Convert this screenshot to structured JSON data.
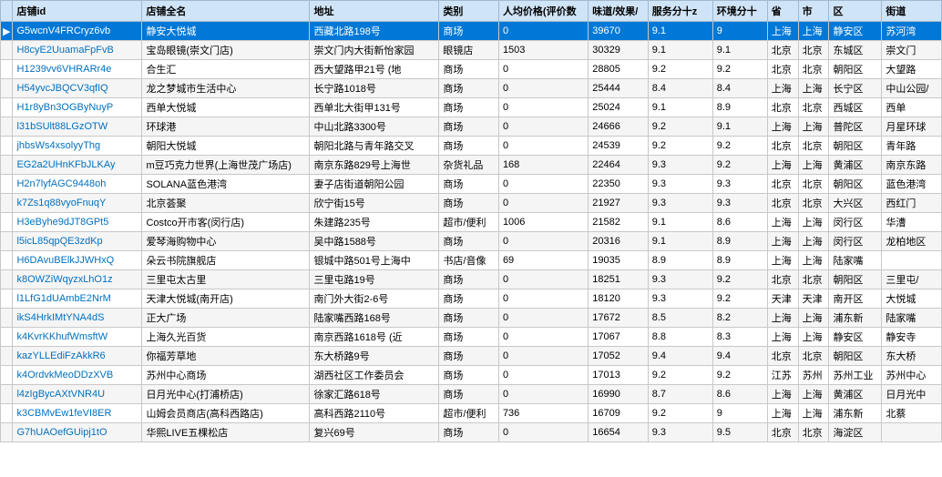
{
  "table": {
    "columns": [
      {
        "key": "arrow",
        "label": ""
      },
      {
        "key": "id",
        "label": "店铺id"
      },
      {
        "key": "full_name",
        "label": "店铺全名"
      },
      {
        "key": "address",
        "label": "地址"
      },
      {
        "key": "category",
        "label": "类别"
      },
      {
        "key": "avg_price",
        "label": "人均价格(评价数"
      },
      {
        "key": "taste",
        "label": "味道/效果/"
      },
      {
        "key": "service",
        "label": "服务分十z"
      },
      {
        "key": "env",
        "label": "环境分十"
      },
      {
        "key": "province",
        "label": "省"
      },
      {
        "key": "city",
        "label": "市"
      },
      {
        "key": "district",
        "label": "区"
      },
      {
        "key": "street",
        "label": "街道"
      }
    ],
    "rows": [
      {
        "arrow": "▶",
        "id": "G5wcnV4FRCryz6vb",
        "full_name": "静安大悦城",
        "address": "西藏北路198号",
        "category": "商场",
        "avg_price": "0",
        "taste": "39670",
        "service": "9.1",
        "env": "9",
        "province": "上海",
        "city": "上海",
        "district": "静安区",
        "street": "苏河湾",
        "selected": true
      },
      {
        "arrow": "",
        "id": "H8cyE2UuamaFpFvB",
        "full_name": "宝岛眼镜(崇文门店)",
        "address": "崇文门内大街新怡家园",
        "category": "眼镜店",
        "avg_price": "1503",
        "taste": "30329",
        "service": "9.1",
        "env": "9.1",
        "province": "北京",
        "city": "北京",
        "district": "东城区",
        "street": "崇文门"
      },
      {
        "arrow": "",
        "id": "H1239vv6VHRARr4e",
        "full_name": "合生汇",
        "address": "西大望路甲21号 (地",
        "category": "商场",
        "avg_price": "0",
        "taste": "28805",
        "service": "9.2",
        "env": "9.2",
        "province": "北京",
        "city": "北京",
        "district": "朝阳区",
        "street": "大望路"
      },
      {
        "arrow": "",
        "id": "H54yvcJBQCV3qfIQ",
        "full_name": "龙之梦城市生活中心",
        "address": "长宁路1018号",
        "category": "商场",
        "avg_price": "0",
        "taste": "25444",
        "service": "8.4",
        "env": "8.4",
        "province": "上海",
        "city": "上海",
        "district": "长宁区",
        "street": "中山公园/"
      },
      {
        "arrow": "",
        "id": "H1r8yBn3OGByNuyP",
        "full_name": "西单大悦城",
        "address": "西单北大街甲131号",
        "category": "商场",
        "avg_price": "0",
        "taste": "25024",
        "service": "9.1",
        "env": "8.9",
        "province": "北京",
        "city": "北京",
        "district": "西城区",
        "street": "西单"
      },
      {
        "arrow": "",
        "id": "l31bSUlt88LGzOTW",
        "full_name": "环球港",
        "address": "中山北路3300号",
        "category": "商场",
        "avg_price": "0",
        "taste": "24666",
        "service": "9.2",
        "env": "9.1",
        "province": "上海",
        "city": "上海",
        "district": "普陀区",
        "street": "月星环球"
      },
      {
        "arrow": "",
        "id": "jhbsWs4xsolyyThg",
        "full_name": "朝阳大悦城",
        "address": "朝阳北路与青年路交叉",
        "category": "商场",
        "avg_price": "0",
        "taste": "24539",
        "service": "9.2",
        "env": "9.2",
        "province": "北京",
        "city": "北京",
        "district": "朝阳区",
        "street": "青年路"
      },
      {
        "arrow": "",
        "id": "EG2a2UHnKFbJLKAy",
        "full_name": "m豆巧克力世界(上海世茂广场店)",
        "address": "南京东路829号上海世",
        "category": "杂货礼品",
        "avg_price": "168",
        "taste": "22464",
        "service": "9.3",
        "env": "9.2",
        "province": "上海",
        "city": "上海",
        "district": "黄浦区",
        "street": "南京东路"
      },
      {
        "arrow": "",
        "id": "H2n7lyfAGC9448oh",
        "full_name": "SOLANA蓝色港湾",
        "address": "妻子店街道朝阳公园",
        "category": "商场",
        "avg_price": "0",
        "taste": "22350",
        "service": "9.3",
        "env": "9.3",
        "province": "北京",
        "city": "北京",
        "district": "朝阳区",
        "street": "蓝色港湾"
      },
      {
        "arrow": "",
        "id": "k7Zs1q88vyoFnuqY",
        "full_name": "北京荟聚",
        "address": "欣宁街15号",
        "category": "商场",
        "avg_price": "0",
        "taste": "21927",
        "service": "9.3",
        "env": "9.3",
        "province": "北京",
        "city": "北京",
        "district": "大兴区",
        "street": "西红门"
      },
      {
        "arrow": "",
        "id": "H3eByhe9dJT8GPt5",
        "full_name": "Costco开市客(闵行店)",
        "address": "朱建路235号",
        "category": "超市/便利",
        "avg_price": "1006",
        "taste": "21582",
        "service": "9.1",
        "env": "8.6",
        "province": "上海",
        "city": "上海",
        "district": "闵行区",
        "street": "华漕"
      },
      {
        "arrow": "",
        "id": "l5icL85qpQE3zdKp",
        "full_name": "爱琴海购物中心",
        "address": "吴中路1588号",
        "category": "商场",
        "avg_price": "0",
        "taste": "20316",
        "service": "9.1",
        "env": "8.9",
        "province": "上海",
        "city": "上海",
        "district": "闵行区",
        "street": "龙柏地区"
      },
      {
        "arrow": "",
        "id": "H6DAvuBElkJJWHxQ",
        "full_name": "朵云书院旗舰店",
        "address": "银城中路501号上海中",
        "category": "书店/音像",
        "avg_price": "69",
        "taste": "19035",
        "service": "8.9",
        "env": "8.9",
        "province": "上海",
        "city": "上海",
        "district": "陆家嘴",
        "street": ""
      },
      {
        "arrow": "",
        "id": "k8OWZiWqyzxLhO1z",
        "full_name": "三里屯太古里",
        "address": "三里屯路19号",
        "category": "商场",
        "avg_price": "0",
        "taste": "18251",
        "service": "9.3",
        "env": "9.2",
        "province": "北京",
        "city": "北京",
        "district": "朝阳区",
        "street": "三里屯/"
      },
      {
        "arrow": "",
        "id": "l1LfG1dUAmbE2NrM",
        "full_name": "天津大悦城(南开店)",
        "address": "南门外大街2-6号",
        "category": "商场",
        "avg_price": "0",
        "taste": "18120",
        "service": "9.3",
        "env": "9.2",
        "province": "天津",
        "city": "天津",
        "district": "南开区",
        "street": "大悦城"
      },
      {
        "arrow": "",
        "id": "ikS4HrkIMtYNA4dS",
        "full_name": "正大广场",
        "address": "陆家嘴西路168号",
        "category": "商场",
        "avg_price": "0",
        "taste": "17672",
        "service": "8.5",
        "env": "8.2",
        "province": "上海",
        "city": "上海",
        "district": "浦东新",
        "street": "陆家嘴"
      },
      {
        "arrow": "",
        "id": "k4KvrKKhufWmsftW",
        "full_name": "上海久光百货",
        "address": "南京西路1618号 (近",
        "category": "商场",
        "avg_price": "0",
        "taste": "17067",
        "service": "8.8",
        "env": "8.3",
        "province": "上海",
        "city": "上海",
        "district": "静安区",
        "street": "静安寺"
      },
      {
        "arrow": "",
        "id": "kazYLLEdiFzAkkR6",
        "full_name": "你福芳草地",
        "address": "东大桥路9号",
        "category": "商场",
        "avg_price": "0",
        "taste": "17052",
        "service": "9.4",
        "env": "9.4",
        "province": "北京",
        "city": "北京",
        "district": "朝阳区",
        "street": "东大桥"
      },
      {
        "arrow": "",
        "id": "k4OrdvkMeoDDzXVB",
        "full_name": "苏州中心商场",
        "address": "湖西社区工作委员会",
        "category": "商场",
        "avg_price": "0",
        "taste": "17013",
        "service": "9.2",
        "env": "9.2",
        "province": "江苏",
        "city": "苏州",
        "district": "苏州工业",
        "street": "苏州中心"
      },
      {
        "arrow": "",
        "id": "l4zIgBycAXtVNR4U",
        "full_name": "日月光中心(打浦桥店)",
        "address": "徐家汇路618号",
        "category": "商场",
        "avg_price": "0",
        "taste": "16990",
        "service": "8.7",
        "env": "8.6",
        "province": "上海",
        "city": "上海",
        "district": "黄浦区",
        "street": "日月光中"
      },
      {
        "arrow": "",
        "id": "k3CBMvEw1feVI8ER",
        "full_name": "山姆会员商店(高科西路店)",
        "address": "高科西路2110号",
        "category": "超市/便利",
        "avg_price": "736",
        "taste": "16709",
        "service": "9.2",
        "env": "9",
        "province": "上海",
        "city": "上海",
        "district": "浦东新",
        "street": "北蔡"
      },
      {
        "arrow": "",
        "id": "G7hUAOefGUipj1tO",
        "full_name": "华熙LIVE五棵松店",
        "address": "复兴69号",
        "category": "商场",
        "avg_price": "0",
        "taste": "16654",
        "service": "9.3",
        "env": "9.5",
        "province": "北京",
        "city": "北京",
        "district": "海淀区",
        "street": ""
      }
    ]
  }
}
